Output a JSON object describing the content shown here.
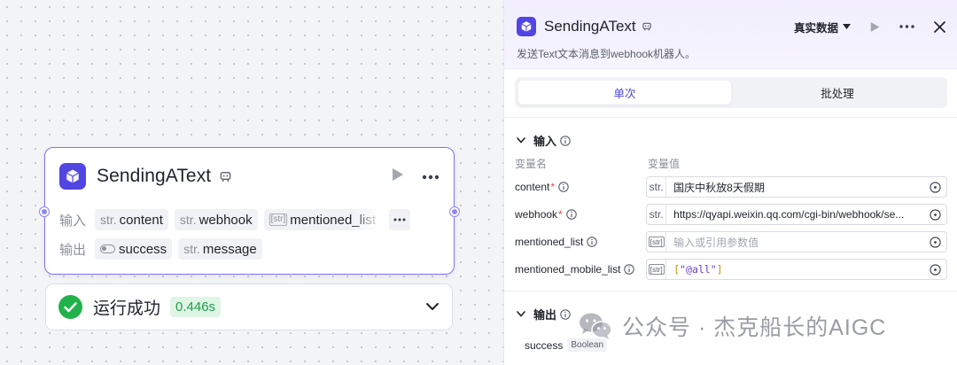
{
  "node": {
    "title": "SendingAText",
    "input_label": "输入",
    "output_label": "输出",
    "inputs": [
      {
        "type": "str.",
        "name": "content"
      },
      {
        "type": "str.",
        "name": "webhook"
      },
      {
        "type": "[str]",
        "name": "mentioned_list"
      }
    ],
    "outputs": [
      {
        "type": "toggle",
        "name": "success"
      },
      {
        "type": "str.",
        "name": "message"
      }
    ]
  },
  "result": {
    "status": "运行成功",
    "time": "0.446s"
  },
  "panel": {
    "title": "SendingAText",
    "data_mode": "真实数据",
    "description": "发送Text文本消息到webhook机器人。",
    "tabs": [
      "单次",
      "批处理"
    ],
    "active_tab": 0,
    "input_section": "输入",
    "col_name": "变量名",
    "col_value": "变量值",
    "params": [
      {
        "name": "content",
        "required": true,
        "type": "str.",
        "value": "国庆中秋放8天假期",
        "placeholder": false
      },
      {
        "name": "webhook",
        "required": true,
        "type": "str.",
        "value": "https://qyapi.weixin.qq.com/cgi-bin/webhook/se...",
        "placeholder": false
      },
      {
        "name": "mentioned_list",
        "required": false,
        "type": "[str]",
        "value": "输入或引用参数值",
        "placeholder": true
      },
      {
        "name": "mentioned_mobile_list",
        "required": false,
        "type": "[str]",
        "value": "[\"@all\"]",
        "placeholder": false
      }
    ],
    "output_section": "输出",
    "outputs": [
      {
        "name": "success",
        "type": "Boolean"
      }
    ]
  },
  "watermark": {
    "text": "公众号 · 杰克船长的AIGC"
  },
  "colors": {
    "accent": "#5146e1",
    "node_border": "#7b73ee",
    "success": "#22b24c",
    "required": "#e5484d"
  }
}
